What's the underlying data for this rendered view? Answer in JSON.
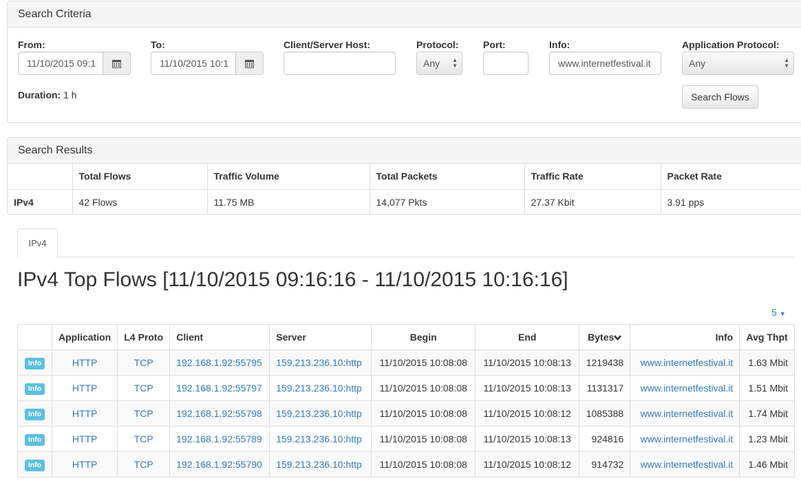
{
  "criteria": {
    "title": "Search Criteria",
    "from_label": "From:",
    "from_value": "11/10/2015 09:1",
    "to_label": "To:",
    "to_value": "11/10/2015 10:1",
    "host_label": "Client/Server Host:",
    "host_value": "",
    "protocol_label": "Protocol:",
    "protocol_value": "Any",
    "port_label": "Port:",
    "port_value": "",
    "info_label": "Info:",
    "info_value": "www.internetfestival.it",
    "app_protocol_label": "Application Protocol:",
    "app_protocol_value": "Any",
    "duration_label": "Duration:",
    "duration_value": "1 h",
    "search_button": "Search Flows"
  },
  "results": {
    "title": "Search Results",
    "headers": [
      "Total Flows",
      "Traffic Volume",
      "Total Packets",
      "Traffic Rate",
      "Packet Rate"
    ],
    "row_label": "IPv4",
    "values": [
      "42 Flows",
      "11.75 MB",
      "14,077 Pkts",
      "27.37 Kbit",
      "3.91 pps"
    ]
  },
  "tabs": {
    "ipv4": "IPv4"
  },
  "flows": {
    "title": "IPv4 Top Flows [11/10/2015 09:16:16 - 11/10/2015 10:16:16]",
    "page_size": "5",
    "headers": {
      "info_col": "",
      "application": "Application",
      "l4": "L4 Proto",
      "client": "Client",
      "server": "Server",
      "begin": "Begin",
      "end": "End",
      "bytes": "Bytes",
      "info": "Info",
      "thpt": "Avg Thpt"
    },
    "rows": [
      {
        "badge": "Info",
        "app": "HTTP",
        "l4": "TCP",
        "client_ip": "192.168.1.92",
        "client_port": "55795",
        "server_ip": "159.213.236.10",
        "server_port": "http",
        "begin": "11/10/2015 10:08:08",
        "end": "11/10/2015 10:08:13",
        "bytes": "1219438",
        "info": "www.internetfestival.it",
        "thpt": "1.63 Mbit"
      },
      {
        "badge": "Info",
        "app": "HTTP",
        "l4": "TCP",
        "client_ip": "192.168.1.92",
        "client_port": "55797",
        "server_ip": "159.213.236.10",
        "server_port": "http",
        "begin": "11/10/2015 10:08:08",
        "end": "11/10/2015 10:08:13",
        "bytes": "1131317",
        "info": "www.internetfestival.it",
        "thpt": "1.51 Mbit"
      },
      {
        "badge": "Info",
        "app": "HTTP",
        "l4": "TCP",
        "client_ip": "192.168.1.92",
        "client_port": "55798",
        "server_ip": "159.213.236.10",
        "server_port": "http",
        "begin": "11/10/2015 10:08:08",
        "end": "11/10/2015 10:08:12",
        "bytes": "1085388",
        "info": "www.internetfestival.it",
        "thpt": "1.74 Mbit"
      },
      {
        "badge": "Info",
        "app": "HTTP",
        "l4": "TCP",
        "client_ip": "192.168.1.92",
        "client_port": "55789",
        "server_ip": "159.213.236.10",
        "server_port": "http",
        "begin": "11/10/2015 10:08:08",
        "end": "11/10/2015 10:08:13",
        "bytes": "924816",
        "info": "www.internetfestival.it",
        "thpt": "1.23 Mbit"
      },
      {
        "badge": "Info",
        "app": "HTTP",
        "l4": "TCP",
        "client_ip": "192.168.1.92",
        "client_port": "55790",
        "server_ip": "159.213.236.10",
        "server_port": "http",
        "begin": "11/10/2015 10:08:08",
        "end": "11/10/2015 10:08:12",
        "bytes": "914732",
        "info": "www.internetfestival.it",
        "thpt": "1.46 Mbit"
      }
    ]
  },
  "icons": {
    "calendar": "calendar-icon",
    "sort": "chevron-down-icon",
    "caret": "caret-down-icon",
    "select_arrows": "select-arrows-icon"
  },
  "colors": {
    "link": "#337ab7",
    "badge": "#5bc0de",
    "panel_heading": "#f5f5f5"
  }
}
